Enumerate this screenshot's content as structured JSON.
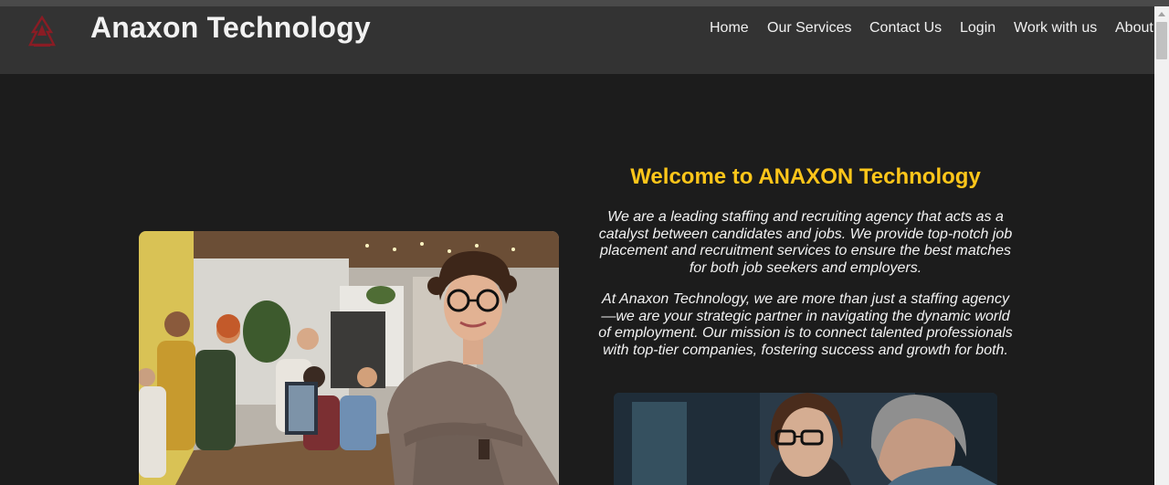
{
  "brand": {
    "name": "Anaxon Technology",
    "logo_icon": "anaxon-logo-icon"
  },
  "nav": {
    "items": [
      {
        "label": "Home"
      },
      {
        "label": "Our Services"
      },
      {
        "label": "Contact Us"
      },
      {
        "label": "Login"
      },
      {
        "label": "Work with us"
      },
      {
        "label": "About"
      }
    ]
  },
  "main": {
    "title": "Welcome to ANAXON Technology",
    "paragraph1": "We are a leading staffing and recruiting agency that acts as a catalyst between candidates and jobs. We provide top-notch job placement and recruitment services to ensure the best matches for both job seekers and employers.",
    "paragraph2": "At Anaxon Technology, we are more than just a staffing agency—we are your strategic partner in navigating the dynamic world of employment. Our mission is to connect talented professionals with top-tier companies, fostering success and growth for both."
  },
  "colors": {
    "accent": "#ffc61a",
    "header_bg": "#333333",
    "page_bg": "#1c1c1c"
  }
}
